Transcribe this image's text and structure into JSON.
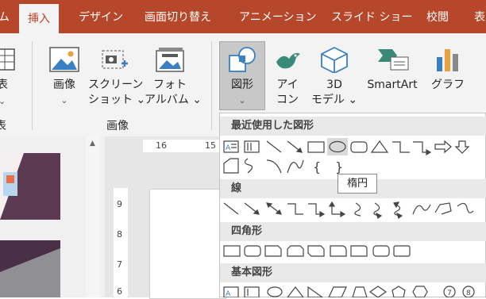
{
  "tabs": [
    {
      "label": "ム"
    },
    {
      "label": "挿入",
      "active": true
    },
    {
      "label": "デザイン"
    },
    {
      "label": "画面切り替え"
    },
    {
      "label": "アニメーション"
    },
    {
      "label": "スライド ショー"
    },
    {
      "label": "校閲"
    },
    {
      "label": "表"
    }
  ],
  "ribbon": {
    "left_partial": {
      "label1": "表",
      "label2": "表"
    },
    "images": {
      "picture": "画像",
      "chev": "⌄",
      "screenshot1": "スクリーン",
      "screenshot2": "ショット ⌄",
      "album1": "フォト",
      "album2": "アルバム ⌄",
      "group": "画像"
    },
    "illust": {
      "shapes1": "図形",
      "shapes2": "⌄",
      "icons1": "アイ",
      "icons2": "コン",
      "model1": "3D",
      "model2": "モデル ⌄",
      "smartart": "SmartArt",
      "chart": "グラフ"
    }
  },
  "ruler": {
    "h1": "16",
    "h2": "15",
    "v1": "9",
    "v2": "8",
    "v3": "7",
    "v4": "6"
  },
  "gallery": {
    "recent": "最近使用した図形",
    "lines": "線",
    "rect": "四角形",
    "basic": "基本図形",
    "tooltip": "楕円"
  },
  "colors": {
    "accent": "#b7472a",
    "ribbon": "#f3f3f3",
    "selected": "#c8c8c8"
  }
}
